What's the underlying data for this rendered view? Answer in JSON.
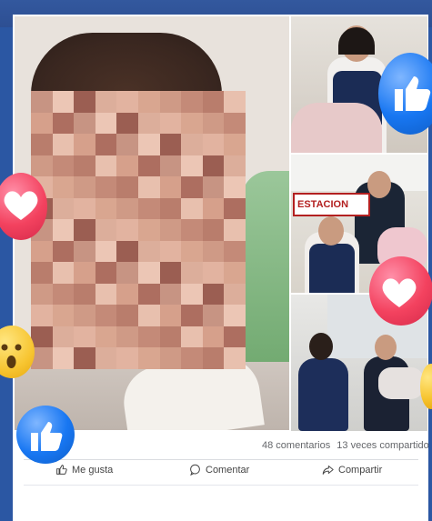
{
  "post": {
    "comments_count": "48 comentarios",
    "shares_count": "13 veces compartido"
  },
  "actions": {
    "like_label": "Me gusta",
    "comment_label": "Comentar",
    "share_label": "Compartir"
  },
  "photo_text": {
    "station_sign": "ESTACION"
  },
  "colors": {
    "background": "#2b57a3",
    "like_blue": "#1877f2",
    "heart_red": "#f3425f",
    "wow_yellow": "#f7c531"
  },
  "icons": [
    "like-icon",
    "comment-icon",
    "share-icon",
    "heart-reaction-icon",
    "like-reaction-icon",
    "wow-reaction-icon"
  ]
}
